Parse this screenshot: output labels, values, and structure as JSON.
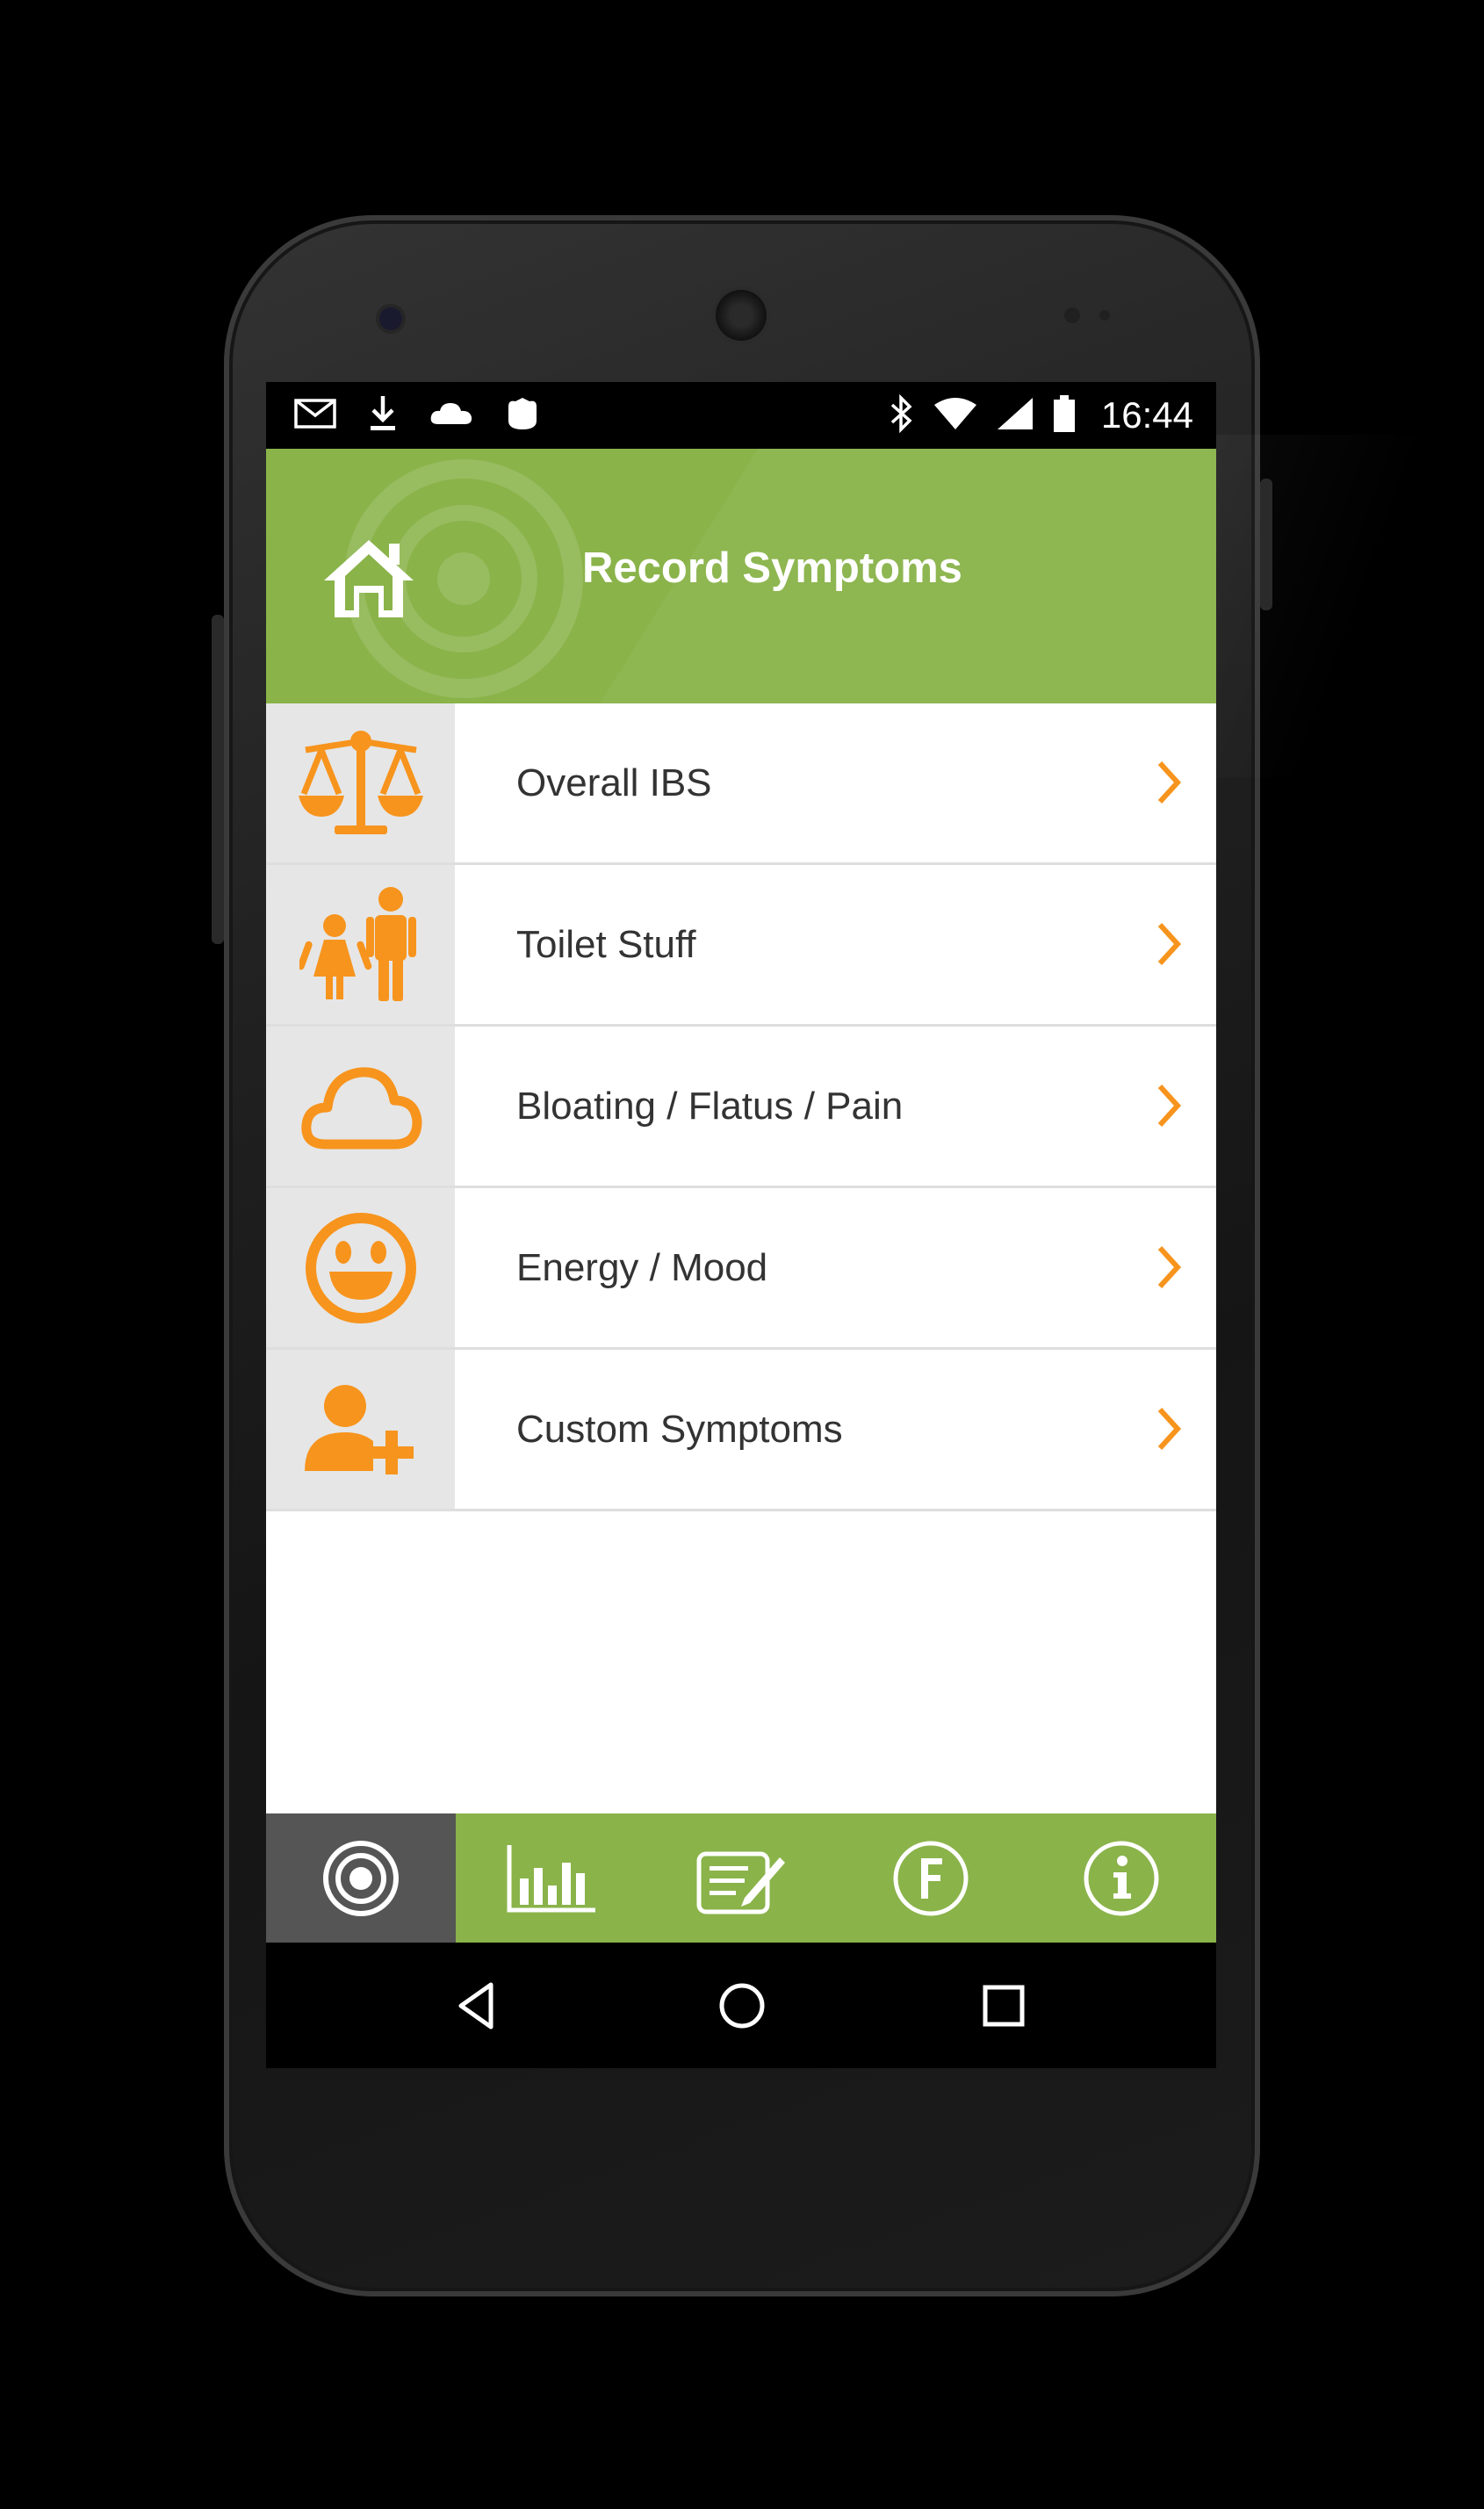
{
  "status_bar": {
    "time": "16:44",
    "left_icons": [
      "mail-icon",
      "download-icon",
      "cloud-icon",
      "app-icon"
    ],
    "right_icons": [
      "bluetooth-icon",
      "wifi-icon",
      "signal-icon",
      "battery-icon"
    ]
  },
  "header": {
    "title": "Record Symptoms",
    "home_icon": "home-icon"
  },
  "menu": {
    "items": [
      {
        "label": "Overall IBS",
        "icon": "scales-icon"
      },
      {
        "label": "Toilet Stuff",
        "icon": "toilet-people-icon"
      },
      {
        "label": "Bloating / Flatus / Pain",
        "icon": "cloud-outline-icon"
      },
      {
        "label": "Energy / Mood",
        "icon": "smiley-icon"
      },
      {
        "label": "Custom Symptoms",
        "icon": "add-person-icon"
      }
    ]
  },
  "tabs": [
    {
      "icon": "target-icon",
      "active": true
    },
    {
      "icon": "bar-chart-icon",
      "active": false
    },
    {
      "icon": "notes-edit-icon",
      "active": false
    },
    {
      "icon": "f-circle-icon",
      "active": false
    },
    {
      "icon": "info-icon",
      "active": false
    }
  ],
  "colors": {
    "accent_green": "#8ab34a",
    "icon_orange": "#f7941d",
    "active_tab": "#555555"
  }
}
